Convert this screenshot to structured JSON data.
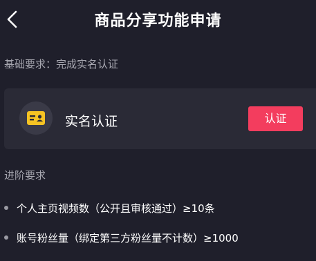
{
  "header": {
    "back_icon": "chevron-left-icon",
    "title": "商品分享功能申请"
  },
  "basic": {
    "label": "基础要求：完成实名认证"
  },
  "card": {
    "icon": "id-card-icon",
    "label": "实名认证",
    "button_label": "认证",
    "button_color": "#f33d5e"
  },
  "advanced": {
    "label": "进阶要求",
    "items": [
      "个人主页视频数（公开且审核通过）≥10条",
      "账号粉丝量（绑定第三方粉丝量不计数）≥1000"
    ]
  },
  "colors": {
    "background": "#1f1f2b",
    "card_background": "#2a2a36",
    "icon_accent": "#f6c323",
    "muted_text": "#a7a7b0"
  }
}
